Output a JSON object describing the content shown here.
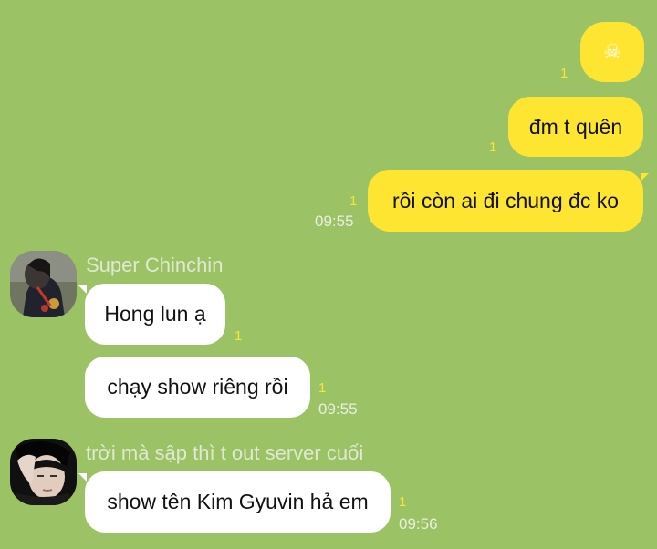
{
  "messages_out": [
    {
      "text": "☠",
      "unread": "1"
    },
    {
      "text": "đm t quên",
      "unread": "1"
    },
    {
      "text": "rồi còn ai đi chung đc ko",
      "unread": "1",
      "time": "09:55"
    }
  ],
  "group1": {
    "sender": "Super Chinchin",
    "messages": [
      {
        "text": "Hong lun ạ",
        "unread": "1"
      },
      {
        "text": "chạy show riêng rồi",
        "unread": "1",
        "time": "09:55"
      }
    ]
  },
  "group2": {
    "sender": "trời mà sập thì t out server cuối",
    "messages": [
      {
        "text": "show tên Kim Gyuvin hả em",
        "unread": "1",
        "time": "09:56"
      }
    ]
  },
  "colors": {
    "background": "#9bc264",
    "outgoing_bubble": "#fde532",
    "incoming_bubble": "#ffffff",
    "unread_count": "#f5e735"
  },
  "icons": {
    "skull": "skull-emoji-icon"
  }
}
